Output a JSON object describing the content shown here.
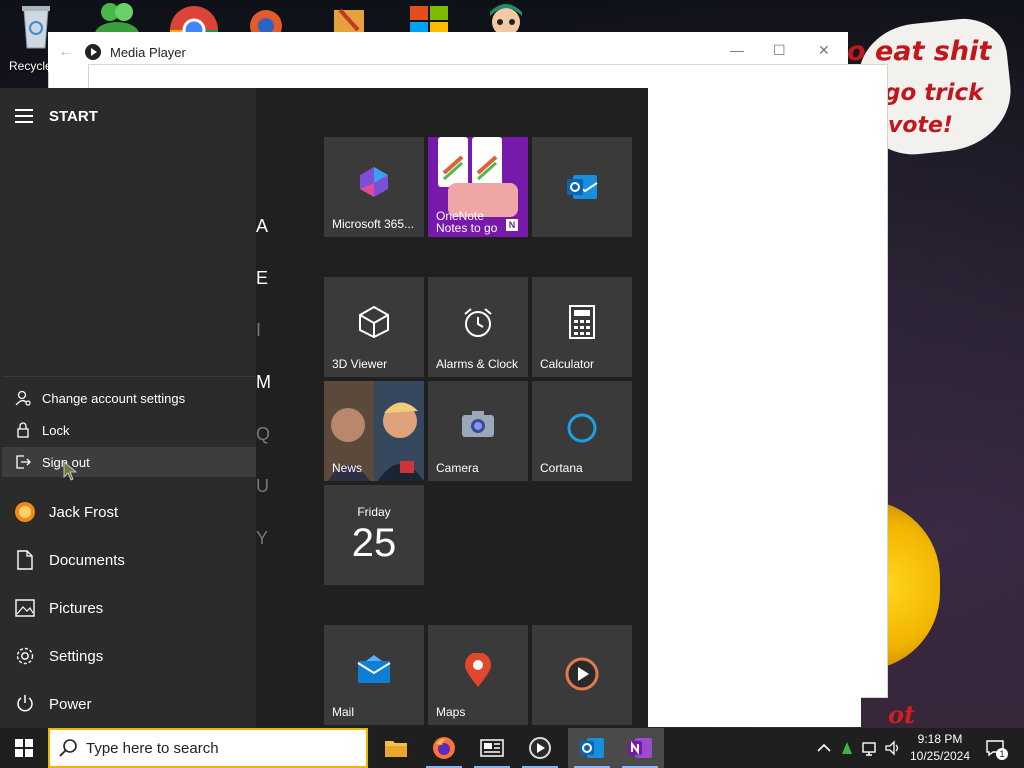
{
  "desktop": {
    "recycle_label": "Recycle",
    "meme_lines": [
      "o eat shit",
      "go trick",
      "vote!"
    ],
    "scribble": "ot"
  },
  "media_player": {
    "title": "Media Player"
  },
  "start_menu": {
    "title": "START",
    "account_menu": {
      "items": [
        {
          "label": "Change account settings",
          "icon": "person-settings-icon"
        },
        {
          "label": "Lock",
          "icon": "lock-icon"
        },
        {
          "label": "Sign out",
          "icon": "sign-out-icon"
        }
      ]
    },
    "nav": [
      {
        "label": "Jack Frost",
        "icon": "user-avatar-icon"
      },
      {
        "label": "Documents",
        "icon": "document-icon"
      },
      {
        "label": "Pictures",
        "icon": "pictures-icon"
      },
      {
        "label": "Settings",
        "icon": "gear-icon"
      },
      {
        "label": "Power",
        "icon": "power-icon"
      }
    ],
    "alpha_letters": [
      "A",
      "E",
      "I",
      "M",
      "Q",
      "U",
      "Y"
    ],
    "tiles": [
      {
        "label": "Microsoft 365...",
        "icon": "microsoft-365-icon"
      },
      {
        "label": "OneNote",
        "sublabel": "Notes to go",
        "icon": "onenote-icon"
      },
      {
        "label": "",
        "icon": "outlook-icon"
      },
      {
        "label": "3D Viewer",
        "icon": "cube-icon"
      },
      {
        "label": "Alarms & Clock",
        "icon": "alarm-clock-icon"
      },
      {
        "label": "Calculator",
        "icon": "calculator-icon"
      },
      {
        "label": "News",
        "icon": "news-icon"
      },
      {
        "label": "Camera",
        "icon": "camera-icon"
      },
      {
        "label": "Cortana",
        "icon": "cortana-icon"
      },
      {
        "label": "Friday",
        "date": "25",
        "icon": "calendar-icon"
      },
      {
        "label": "Mail",
        "icon": "mail-icon"
      },
      {
        "label": "Maps",
        "icon": "map-pin-icon"
      },
      {
        "label": "",
        "icon": "media-player-icon"
      }
    ]
  },
  "taskbar": {
    "search_placeholder": "Type here to search",
    "time": "9:18 PM",
    "date": "10/25/2024",
    "notification_count": "1"
  },
  "colors": {
    "start_bg": "#202020",
    "tile_bg": "#3a3a3a",
    "search_border": "#f0b400",
    "taskbar_bg": "#1f1f1f"
  }
}
